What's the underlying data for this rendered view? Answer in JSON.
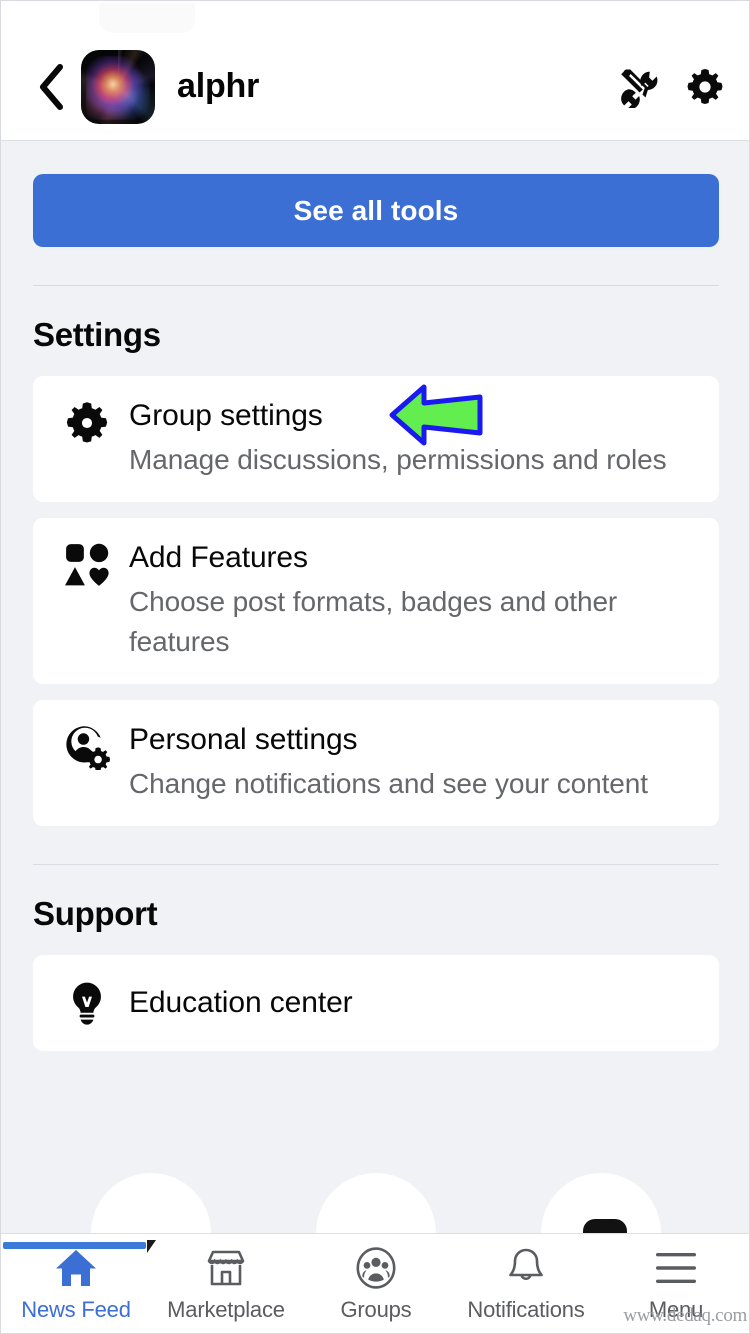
{
  "header": {
    "back_icon": "chevron-left-icon",
    "avatar_alt": "group-avatar",
    "group_name": "alphr",
    "tools_icon": "tools-wrench-screwdriver-icon",
    "settings_icon": "gear-icon"
  },
  "main": {
    "cta_label": "See all tools",
    "sections": [
      {
        "title": "Settings",
        "items": [
          {
            "icon": "gear-icon",
            "title": "Group settings",
            "subtitle": "Manage discussions, permissions and roles",
            "annotated": true
          },
          {
            "icon": "shapes-grid-icon",
            "title": "Add Features",
            "subtitle": "Choose post formats, badges and other features",
            "annotated": false
          },
          {
            "icon": "person-gear-icon",
            "title": "Personal settings",
            "subtitle": "Change notifications and see your content",
            "annotated": false
          }
        ]
      },
      {
        "title": "Support",
        "items": [
          {
            "icon": "lightbulb-icon",
            "title": "Education center",
            "subtitle": "",
            "annotated": false
          }
        ]
      }
    ]
  },
  "bottom_nav": {
    "items": [
      {
        "label": "News Feed",
        "icon": "home-icon",
        "active": true
      },
      {
        "label": "Marketplace",
        "icon": "storefront-icon",
        "active": false
      },
      {
        "label": "Groups",
        "icon": "groups-people-icon",
        "active": false
      },
      {
        "label": "Notifications",
        "icon": "bell-icon",
        "active": false
      },
      {
        "label": "Menu",
        "icon": "hamburger-menu-icon",
        "active": false
      }
    ]
  },
  "annotation": {
    "arrow_direction": "left",
    "fill_color": "#63ee4f",
    "stroke_color": "#1a19ef"
  },
  "watermark": "www.dedaq.com",
  "colors": {
    "accent_blue": "#3b6fd4",
    "page_background": "#f0f2f5",
    "card_background": "#ffffff",
    "primary_text": "#080809",
    "secondary_text": "#65676b"
  }
}
